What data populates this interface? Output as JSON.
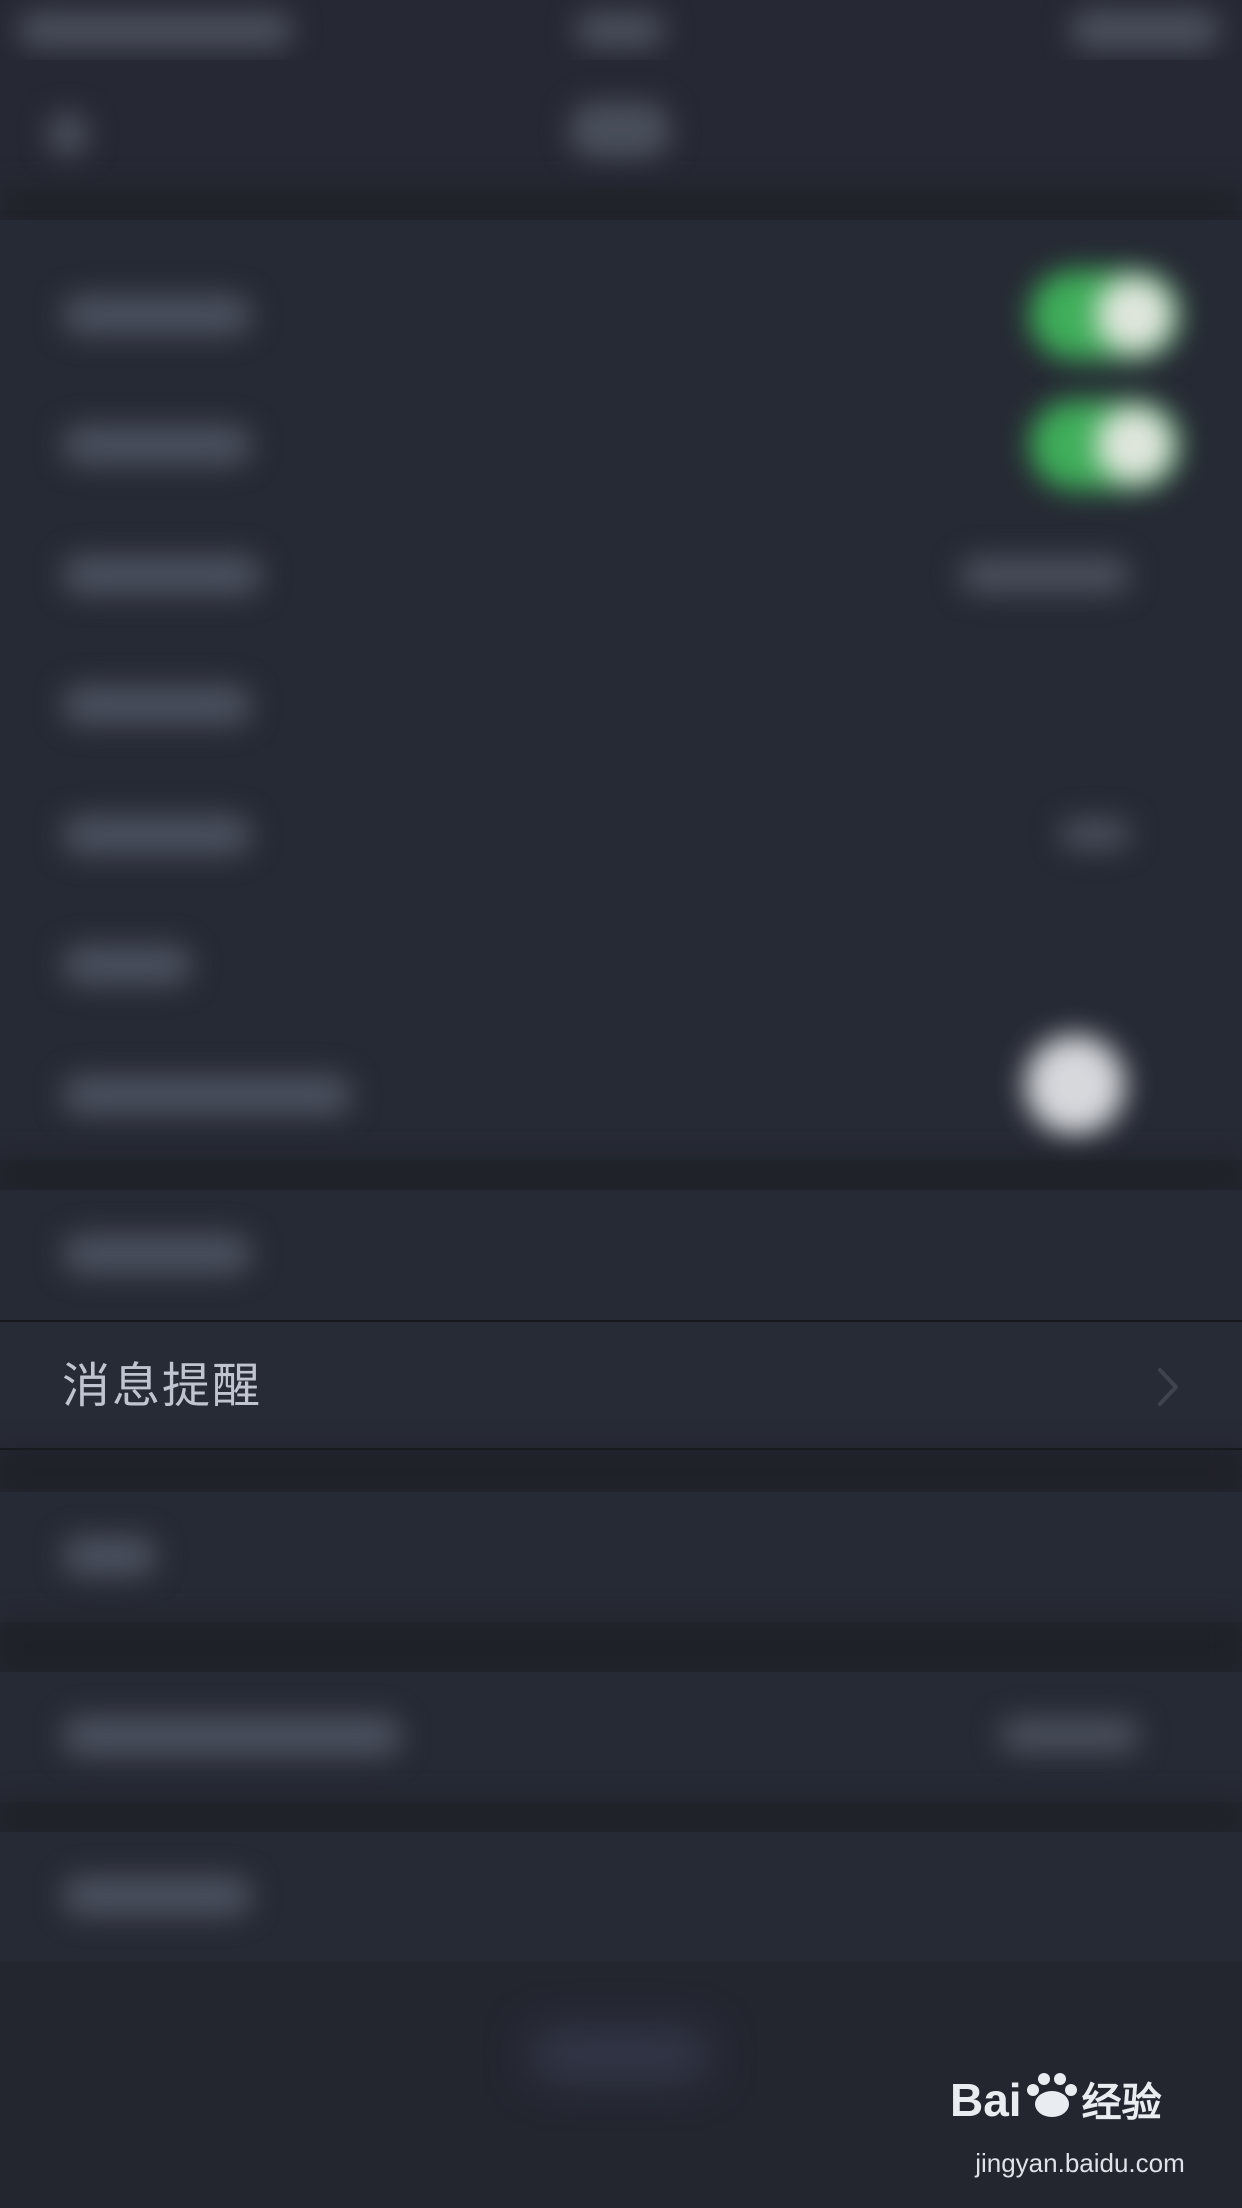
{
  "settings": {
    "highlighted_row": {
      "label": "消息提醒",
      "icon": "chevron-right-icon"
    }
  },
  "watermark": {
    "logo_text": "Bai",
    "logo_suffix": "经验",
    "url": "jingyan.baidu.com",
    "logo_icon": "baidu-paw-icon"
  },
  "colors": {
    "toggle_on": "#3fae5a",
    "background": "#23262f"
  }
}
